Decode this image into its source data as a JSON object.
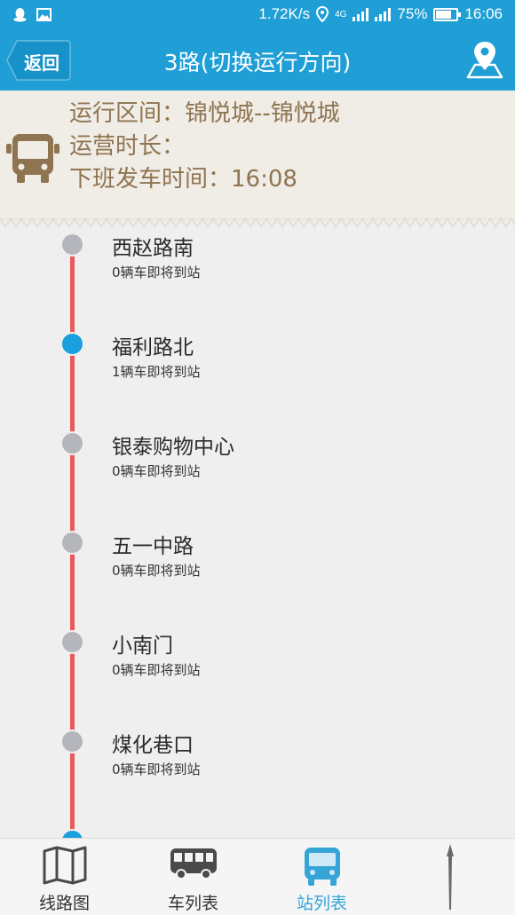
{
  "status_bar": {
    "network_speed": "1.72K/s",
    "network_type": "4G",
    "battery_percent": "75%",
    "battery_level": 0.75,
    "time": "16:06",
    "icons": [
      "qq-icon",
      "image-icon",
      "location-icon",
      "signal-icon",
      "battery-icon"
    ]
  },
  "header": {
    "back_label": "返回",
    "title": "3路(切换运行方向)",
    "map_icon": "map-pin-icon",
    "bar_color": "#1f9fd6"
  },
  "info": {
    "range": "运行区间：锦悦城--锦悦城",
    "duration": "运营时长：",
    "last_bus": "下班发车时间：16:08",
    "text_color": "#8f7451",
    "icon": "bus-icon"
  },
  "stations": [
    {
      "name": "西赵路南",
      "status": "0辆车即将到站",
      "active": false
    },
    {
      "name": "福利路北",
      "status": "1辆车即将到站",
      "active": true
    },
    {
      "name": "银泰购物中心",
      "status": "0辆车即将到站",
      "active": false
    },
    {
      "name": "五一中路",
      "status": "0辆车即将到站",
      "active": false
    },
    {
      "name": "小南门",
      "status": "0辆车即将到站",
      "active": false
    },
    {
      "name": "煤化巷口",
      "status": "0辆车即将到站",
      "active": false
    }
  ],
  "tabs": [
    {
      "label": "线路图",
      "icon": "map-icon",
      "active": false
    },
    {
      "label": "车列表",
      "icon": "bus-list-icon",
      "active": false
    },
    {
      "label": "站列表",
      "icon": "bus-stop-icon",
      "active": true
    }
  ],
  "colors": {
    "rail": "#e9595b",
    "active_dot": "#1aa0dc",
    "inactive_dot": "#b4b6bb",
    "active_tab": "#35a5d8"
  }
}
